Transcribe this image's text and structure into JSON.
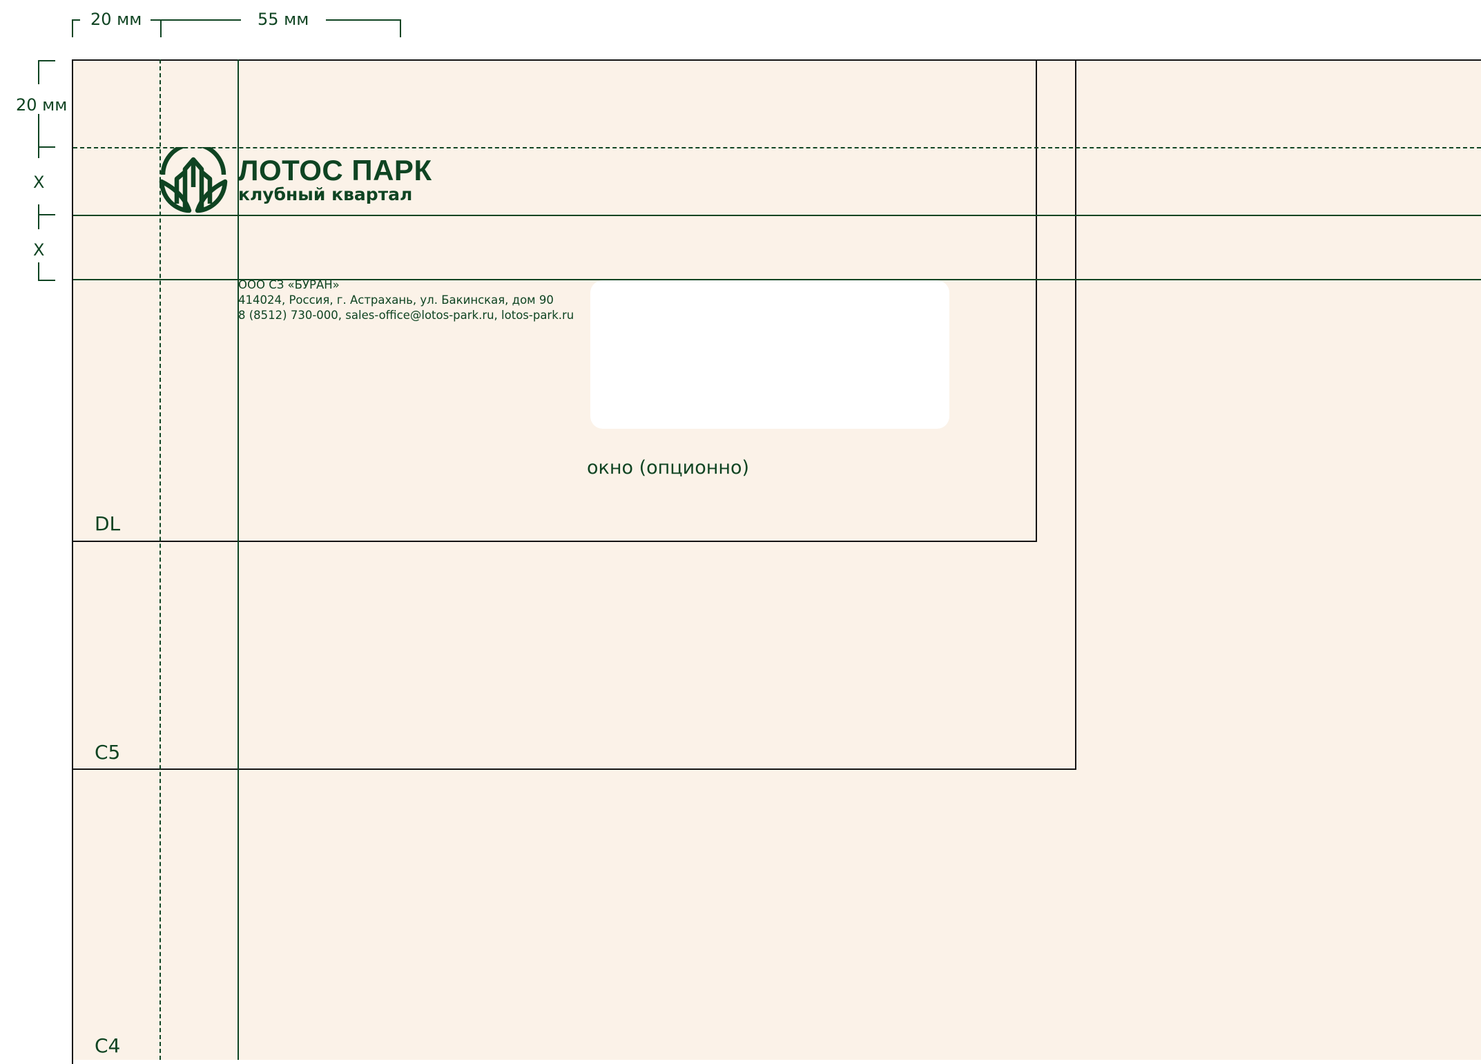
{
  "dimensions": {
    "top_margin": "20 мм",
    "content_offset": "55 мм",
    "side_margin": "20 мм",
    "logo_unit_1": "X",
    "logo_unit_2": "X"
  },
  "envelopes": {
    "dl": "DL",
    "c5": "C5",
    "c4": "C4"
  },
  "logo": {
    "title": "ЛОТОС ПАРК",
    "subtitle": "клубный квартал"
  },
  "sender": {
    "company": "ООО СЗ «БУРАН»",
    "address": "414024, Россия, г. Астрахань, ул. Бакинская, дом 90",
    "contacts": "8 (8512) 730-000, sales-office@lotos-park.ru, lotos-park.ru"
  },
  "window": {
    "caption": "окно (опционно)"
  },
  "colors": {
    "brand_green": "#0f4422",
    "paper": "#fbf2e8",
    "frame": "#141414"
  }
}
